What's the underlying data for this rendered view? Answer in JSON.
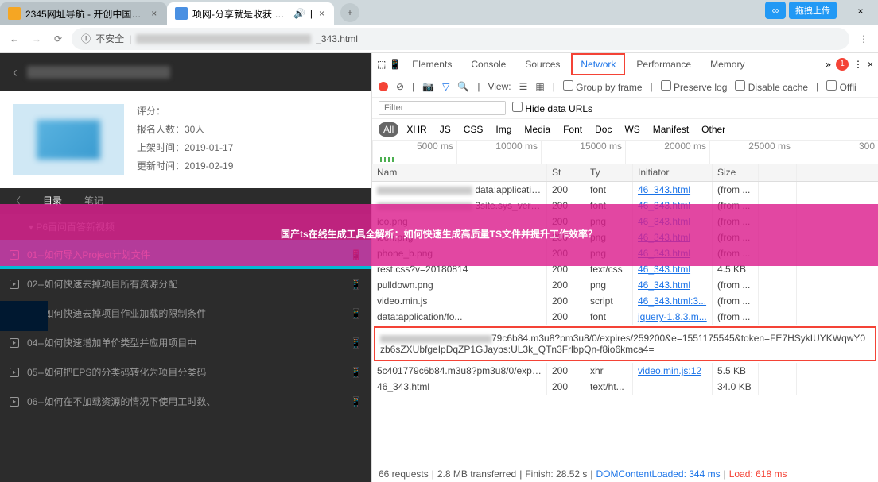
{
  "browser_tabs": [
    {
      "title": "2345网址导航 - 开创中国百年品",
      "active": false
    },
    {
      "title": "项网-分享就是收获 — 一起分",
      "active": true
    }
  ],
  "upload_label": "拖拽上传",
  "address": {
    "warning": "不安全",
    "suffix": "_343.html"
  },
  "course": {
    "rating_label": "评分：",
    "enroll_label": "报名人数：30人",
    "listed_label": "上架时间：2019-01-17",
    "updated_label": "更新时间：2019-02-19",
    "tabs": [
      "目录",
      "笔记"
    ],
    "section": "P6百问百答新视频",
    "lessons": [
      "01--如何导入Project计划文件",
      "02--如何快速去掉项目所有资源分配",
      "03--如何快速去掉项目作业加载的限制条件",
      "04--如何快速增加单价类型并应用项目中",
      "05--如何把EPS的分类码转化为项目分类码",
      "06--如何在不加载资源的情况下使用工时数、"
    ]
  },
  "devtools": {
    "tabs": [
      "Elements",
      "Console",
      "Sources",
      "Network",
      "Performance",
      "Memory"
    ],
    "more": "»",
    "err_count": "1",
    "toolbar": {
      "view": "View:",
      "group": "Group by frame",
      "preserve": "Preserve log",
      "disable": "Disable cache",
      "offline": "Offli"
    },
    "filter_ph": "Filter",
    "hide_data": "Hide data URLs",
    "types": [
      "All",
      "XHR",
      "JS",
      "CSS",
      "Img",
      "Media",
      "Font",
      "Doc",
      "WS",
      "Manifest",
      "Other"
    ],
    "timeline": [
      "5000 ms",
      "10000 ms",
      "15000 ms",
      "20000 ms",
      "25000 ms",
      "300"
    ],
    "columns": [
      "Nam",
      "St",
      "Ty",
      "Initiator",
      "Size",
      ""
    ],
    "rows": [
      {
        "name_blur": true,
        "name": "data:application/x-...",
        "st": "200",
        "ty": "font",
        "in": "46_343.html",
        "sz": "(from ..."
      },
      {
        "name_blur": true,
        "name": "3site.sys_version)",
        "st": "200",
        "ty": "font",
        "in": "46_343.html",
        "sz": "(from ..."
      },
      {
        "name_blur": false,
        "name": "ico.png",
        "st": "200",
        "ty": "png",
        "in": "46_343.html",
        "sz": "(from ..."
      },
      {
        "name_blur": false,
        "name": "icon.png",
        "st": "200",
        "ty": "png",
        "in": "46_343.html",
        "sz": "(from ..."
      },
      {
        "name_blur": false,
        "name": "phone_b.png",
        "st": "200",
        "ty": "png",
        "in": "46_343.html",
        "sz": "(from ..."
      },
      {
        "name_blur": false,
        "name": "rest.css?v=20180814",
        "st": "200",
        "ty": "text/css",
        "in": "46_343.html",
        "sz": "4.5 KB"
      },
      {
        "name_blur": false,
        "name": "pulldown.png",
        "st": "200",
        "ty": "png",
        "in": "46_343.html",
        "sz": "(from ..."
      },
      {
        "name_blur": false,
        "name": "video.min.js",
        "st": "200",
        "ty": "script",
        "in": "46_343.html:3...",
        "sz": "(from ..."
      },
      {
        "name_blur": false,
        "name": "data:application/fo...",
        "st": "200",
        "ty": "font",
        "in": "jquery-1.8.3.m...",
        "sz": "(from ..."
      }
    ],
    "selected_url": "79c6b84.m3u8?pm3u8/0/expires/259200&e=1551175545&token=FE7HSykIUYKWqwY0zb6sZXUbfgeIpDqZP1GJaybs:UL3k_QTn3FrlbpQn-f8io6kmca4=",
    "rows2": [
      {
        "name": "5c401779c6b84.m3u8?pm3u8/0/expir...",
        "st": "200",
        "ty": "xhr",
        "in": "video.min.js:12",
        "sz": "5.5 KB"
      },
      {
        "name": "46_343.html",
        "st": "200",
        "ty": "text/ht...",
        "in": "",
        "sz": "34.0 KB"
      }
    ],
    "status": {
      "reqs": "66 requests",
      "xfer": "2.8 MB transferred",
      "finish": "Finish: 28.52 s",
      "dom": "DOMContentLoaded: 344 ms",
      "load": "Load: 618 ms"
    }
  },
  "overlay_text": "国产ts在线生成工具全解析：如何快速生成高质量TS文件并提升工作效率？"
}
